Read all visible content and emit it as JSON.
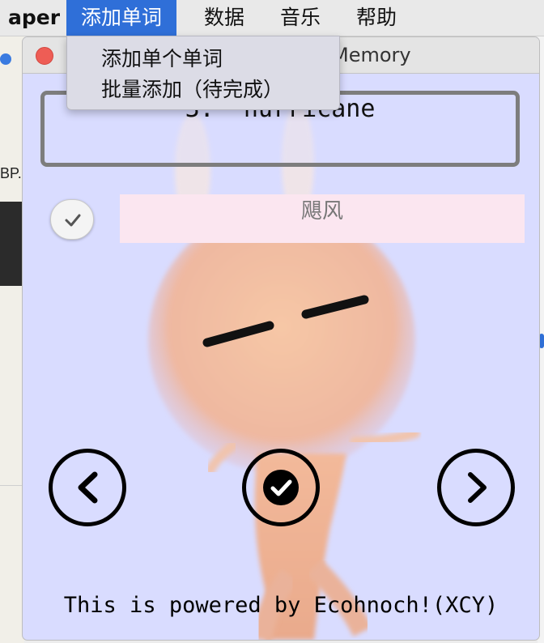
{
  "menubar": {
    "app_name": "aper",
    "menus": [
      "添加单词",
      "数据",
      "音乐",
      "帮助"
    ]
  },
  "dropdown": {
    "items": [
      "添加单个单词",
      "批量添加（待完成）"
    ]
  },
  "background": {
    "partial_label": "BP."
  },
  "window": {
    "title": "Memory"
  },
  "word": {
    "display": "3:  hurricane"
  },
  "meaning": {
    "text": "飓风"
  },
  "footer": {
    "text": "This is powered by Ecohnoch!(XCY)"
  },
  "colors": {
    "window_bg": "#d9dcff",
    "menu_highlight": "#2f6fd8",
    "meaning_bg": "#fbe6f0",
    "close_button": "#ee5d55"
  },
  "icons": [
    "chevron-left-icon",
    "check-circle-icon",
    "chevron-right-icon",
    "checkmark-icon"
  ]
}
